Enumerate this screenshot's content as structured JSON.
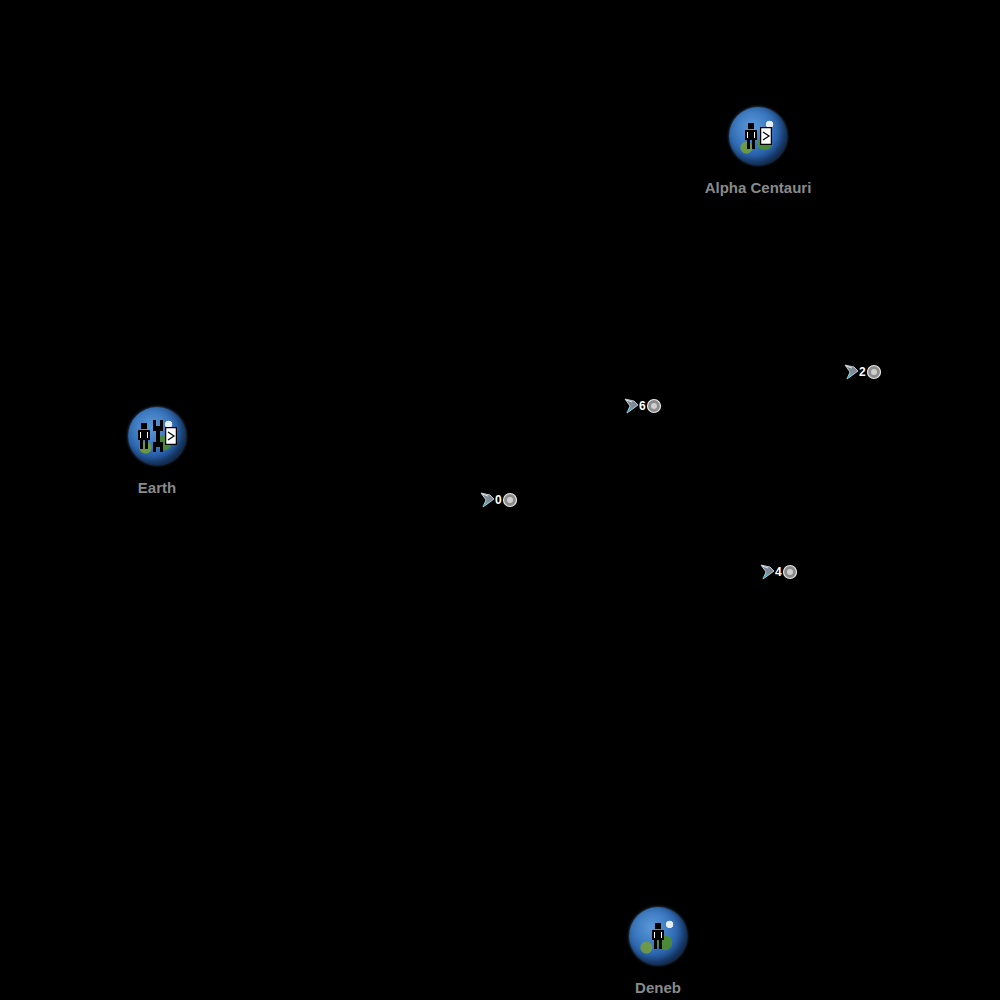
{
  "planets": [
    {
      "name": "Alpha Centauri",
      "population": true,
      "shipyard": false,
      "depot": true
    },
    {
      "name": "Earth",
      "population": true,
      "shipyard": true,
      "depot": true
    },
    {
      "name": "Deneb",
      "population": true,
      "shipyard": false,
      "depot": false
    }
  ],
  "fleets": [
    {
      "label": "6"
    },
    {
      "label": "2"
    },
    {
      "label": "0"
    },
    {
      "label": "4"
    }
  ]
}
